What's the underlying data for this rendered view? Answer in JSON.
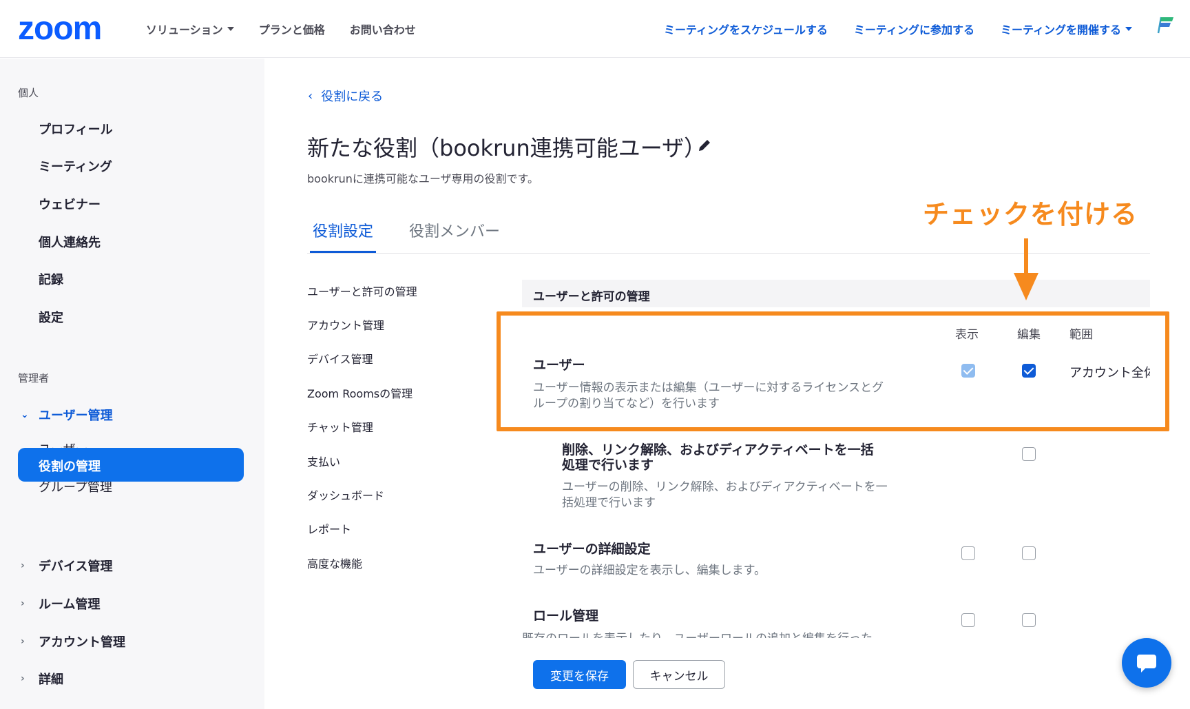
{
  "header": {
    "logo": "zoom",
    "nav_left": [
      "ソリューション",
      "プランと価格",
      "お問い合わせ"
    ],
    "nav_right": [
      "ミーティングをスケジュールする",
      "ミーティングに参加する",
      "ミーティングを開催する"
    ]
  },
  "sidebar": {
    "personal_label": "個人",
    "personal_items": [
      "プロフィール",
      "ミーティング",
      "ウェビナー",
      "個人連絡先",
      "記録",
      "設定"
    ],
    "admin_label": "管理者",
    "user_mgmt": "ユーザー管理",
    "user_mgmt_sub": [
      "ユーザー",
      "グループ管理"
    ],
    "active_item": "役割の管理",
    "groups": [
      "デバイス管理",
      "ルーム管理",
      "アカウント管理",
      "詳細"
    ]
  },
  "main": {
    "back_link": "役割に戻る",
    "title": "新たな役割（bookrun連携可能ユーザ）",
    "description": "bookrunに連携可能なユーザ専用の役割です。",
    "tabs": [
      "役割設定",
      "役割メンバー"
    ],
    "categories": [
      "ユーザーと許可の管理",
      "アカウント管理",
      "デバイス管理",
      "Zoom Roomsの管理",
      "チャット管理",
      "支払い",
      "ダッシュボード",
      "レポート",
      "高度な機能"
    ],
    "section_title": "ユーザーと許可の管理",
    "columns": [
      "表示",
      "編集",
      "範囲"
    ],
    "permissions": [
      {
        "title": "ユーザー",
        "desc": [
          "ユーザー情報の表示または編集（ユーザーに対するライセンスとグ",
          "ループの割り当てなど）を行います"
        ],
        "scope": "アカウント全体"
      },
      {
        "title": [
          "削除、リンク解除、およびディアクティベートを一括",
          "処理で行います"
        ],
        "desc": [
          "ユーザーの削除、リンク解除、およびディアクティベートを一",
          "括処理で行います"
        ]
      },
      {
        "title": "ユーザーの詳細設定",
        "desc": [
          "ユーザーの詳細設定を表示し、編集します。"
        ]
      },
      {
        "title": "ロール管理",
        "desc": [
          "既存のロールを表示したり、ユーザーロールの追加と編集を行った"
        ]
      }
    ],
    "save_button": "変更を保存",
    "cancel_button": "キャンセル"
  },
  "annotation": {
    "text": "チェックを付ける",
    "color": "#f68a1e"
  },
  "colors": {
    "brand": "#0b5cff",
    "link": "#0e5bd7",
    "active": "#0e71eb",
    "highlight": "#f68a1e"
  }
}
